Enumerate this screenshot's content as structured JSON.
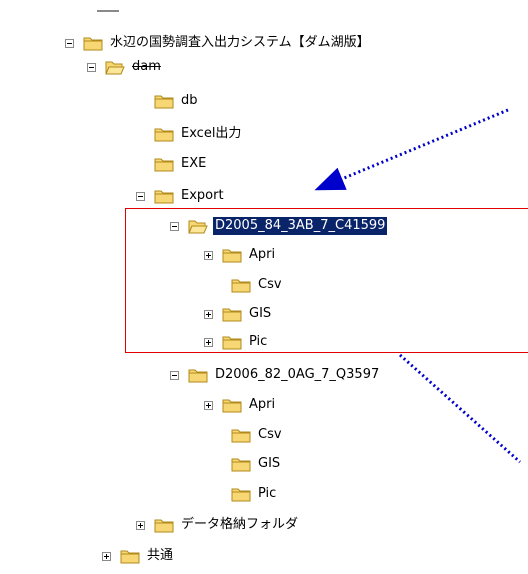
{
  "tree": {
    "nodes": [
      {
        "label": "水辺の国勢調査入出力システム【ダム湖版】",
        "expander": "minus",
        "level": 0
      },
      {
        "label": "dam",
        "expander": "minus",
        "level": 1,
        "struck": true
      },
      {
        "label": "db",
        "expander": "none",
        "level": 2
      },
      {
        "label": "Excel出力",
        "expander": "none",
        "level": 2
      },
      {
        "label": "EXE",
        "expander": "none",
        "level": 2
      },
      {
        "label": "Export",
        "expander": "minus",
        "level": 2
      },
      {
        "label": "D2005_84_3AB_7_C41599",
        "expander": "minus",
        "level": 3,
        "selected": true
      },
      {
        "label": "Apri",
        "expander": "plus",
        "level": 4
      },
      {
        "label": "Csv",
        "expander": "none",
        "level": 4
      },
      {
        "label": "GIS",
        "expander": "plus",
        "level": 4
      },
      {
        "label": "Pic",
        "expander": "plus",
        "level": 4
      },
      {
        "label": "D2006_82_0AG_7_Q3597",
        "expander": "minus",
        "level": 3
      },
      {
        "label": "Apri",
        "expander": "plus",
        "level": 4
      },
      {
        "label": "Csv",
        "expander": "none",
        "level": 4
      },
      {
        "label": "GIS",
        "expander": "none",
        "level": 4
      },
      {
        "label": "Pic",
        "expander": "none",
        "level": 4
      },
      {
        "label": "データ格納フォルダ",
        "expander": "plus",
        "level": 2
      },
      {
        "label": "共通",
        "expander": "plus",
        "level": 1
      }
    ]
  },
  "colors": {
    "folder_fill": "#f7d774",
    "folder_stroke": "#b08a1a",
    "selection": "#0a246a",
    "highlight_box": "#e00000",
    "arrow": "#0000cc"
  },
  "icons": {
    "expander_minus": "minus-box-icon",
    "expander_plus": "plus-box-icon",
    "folder": "folder-icon",
    "folder_open": "open-folder-icon"
  }
}
